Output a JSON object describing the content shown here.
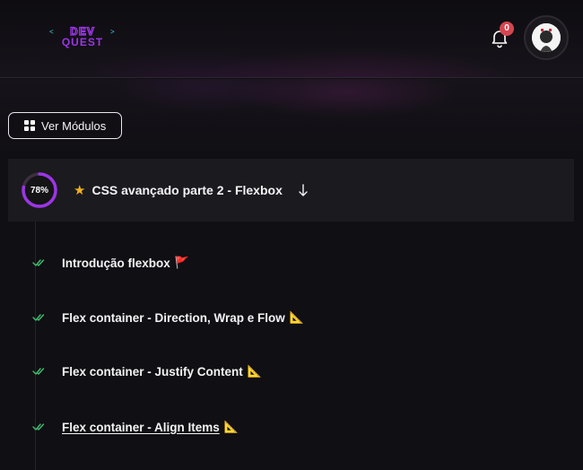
{
  "header": {
    "logo_line1": "DEV",
    "logo_line2": "QUEST",
    "notification_count": "0"
  },
  "modules_button": {
    "label": "Ver Módulos"
  },
  "module": {
    "progress_percent": 78,
    "progress_label": "78%",
    "title": "CSS avançado parte 2 - Flexbox",
    "star": "★",
    "toggle_arrow": "↓"
  },
  "lessons": [
    {
      "title": "Introdução flexbox",
      "emoji": "🚩",
      "completed": true,
      "active": false
    },
    {
      "title": "Flex container - Direction, Wrap e Flow",
      "emoji": "📐",
      "completed": true,
      "active": false
    },
    {
      "title": "Flex container - Justify Content",
      "emoji": "📐",
      "completed": true,
      "active": false
    },
    {
      "title": "Flex container - Align Items",
      "emoji": "📐",
      "completed": true,
      "active": true
    }
  ],
  "colors": {
    "accent_purple": "#9c35e6",
    "check_green": "#3fbe6f",
    "badge_red": "#d64550",
    "star_gold": "#f2b11d"
  },
  "icons": [
    "grid-icon",
    "bell-icon",
    "star-icon",
    "arrow-down-icon",
    "check-double-icon",
    "flag-icon",
    "triangular-ruler-icon"
  ]
}
